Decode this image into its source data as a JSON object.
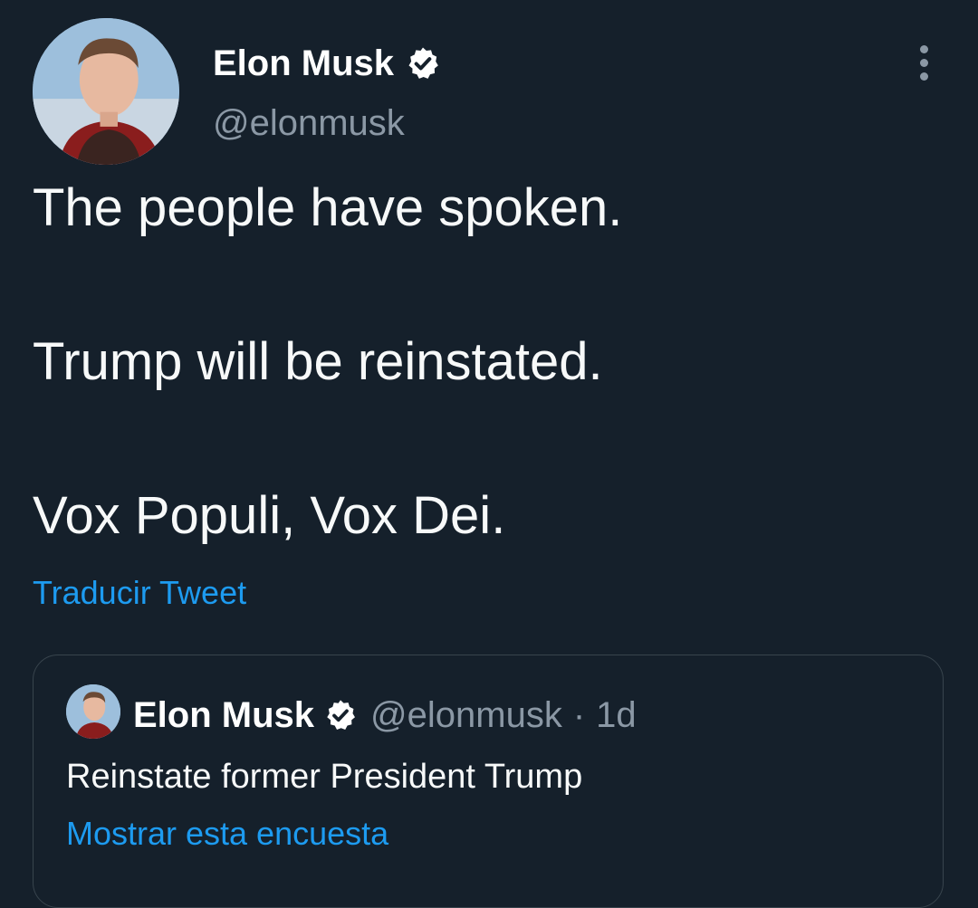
{
  "colors": {
    "background": "#15202b",
    "primary_text": "#f7f9f9",
    "secondary_text": "#8b98a5",
    "link": "#1d9bf0",
    "border": "#38444d"
  },
  "tweet": {
    "author": {
      "name": "Elon Musk",
      "handle": "@elonmusk",
      "verified_icon": "verified-badge-icon",
      "avatar_icon": "user-avatar"
    },
    "more_icon": "more-options-vertical-icon",
    "lines": [
      "The people have spoken.",
      "Trump will be reinstated.",
      "Vox Populi, Vox Dei."
    ],
    "translate_label": "Traducir Tweet"
  },
  "quoted_tweet": {
    "author": {
      "name": "Elon Musk",
      "handle": "@elonmusk",
      "verified_icon": "verified-badge-icon"
    },
    "separator": "·",
    "time": "1d",
    "text": "Reinstate former President Trump",
    "poll_link_label": "Mostrar esta encuesta"
  }
}
